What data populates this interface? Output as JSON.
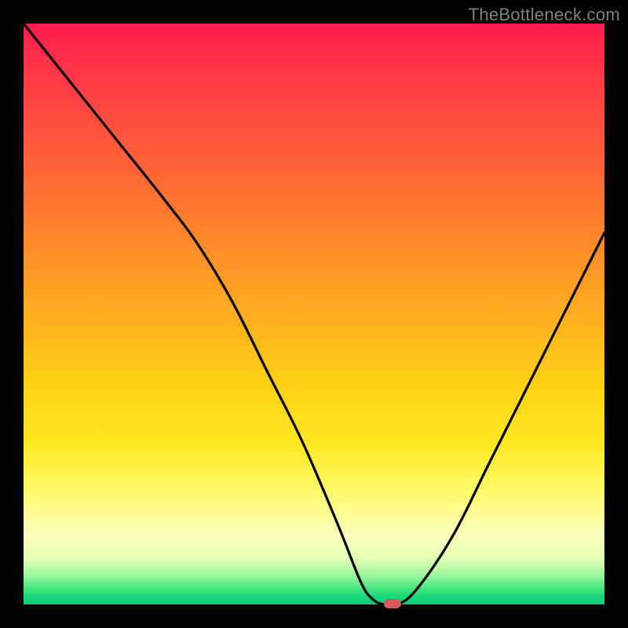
{
  "watermark": "TheBottleneck.com",
  "chart_data": {
    "type": "line",
    "title": "",
    "xlabel": "",
    "ylabel": "",
    "xlim": [
      0,
      100
    ],
    "ylim": [
      0,
      100
    ],
    "grid": false,
    "series": [
      {
        "name": "bottleneck-curve",
        "x": [
          0,
          8,
          16,
          24,
          30,
          36,
          42,
          48,
          54,
          58,
          60,
          62,
          64.5,
          68,
          74,
          80,
          86,
          92,
          98,
          100
        ],
        "y": [
          100,
          90,
          80,
          70,
          62,
          52,
          40,
          28,
          14,
          4,
          1,
          0,
          0,
          3,
          12,
          24,
          36,
          48,
          60,
          64
        ]
      }
    ],
    "marker": {
      "x": 63.5,
      "y": 0.2,
      "label": "optimal-point"
    },
    "background_gradient_stops": [
      {
        "pos": 0,
        "color": "#ff1a4f"
      },
      {
        "pos": 50,
        "color": "#ffb41e"
      },
      {
        "pos": 80,
        "color": "#fff965"
      },
      {
        "pos": 95,
        "color": "#9cf79c"
      },
      {
        "pos": 100,
        "color": "#0ccf78"
      }
    ]
  }
}
